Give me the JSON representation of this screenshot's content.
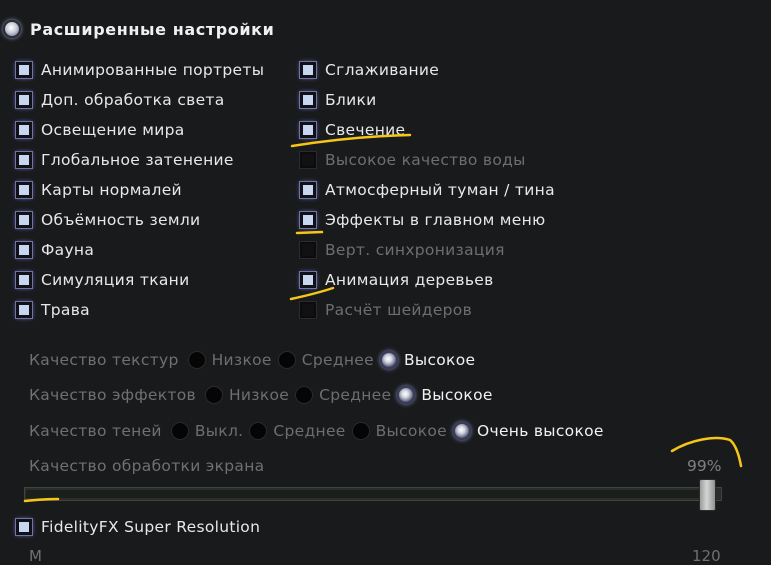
{
  "section": {
    "title": "Расширенные настройки"
  },
  "checkboxes_left": [
    {
      "label": "Анимированные портреты",
      "checked": true
    },
    {
      "label": "Доп. обработка света",
      "checked": true
    },
    {
      "label": "Освещение мира",
      "checked": true
    },
    {
      "label": "Глобальное затенение",
      "checked": true
    },
    {
      "label": "Карты нормалей",
      "checked": true
    },
    {
      "label": "Объёмность земли",
      "checked": true
    },
    {
      "label": "Фауна",
      "checked": true
    },
    {
      "label": "Симуляция ткани",
      "checked": true
    },
    {
      "label": "Трава",
      "checked": true
    }
  ],
  "checkboxes_right": [
    {
      "label": "Сглаживание",
      "checked": true
    },
    {
      "label": "Блики",
      "checked": true
    },
    {
      "label": "Свечение",
      "checked": true
    },
    {
      "label": "Высокое качество воды",
      "checked": false
    },
    {
      "label": "Атмосферный туман / тина",
      "checked": true
    },
    {
      "label": "Эффекты в главном меню",
      "checked": true
    },
    {
      "label": "Верт. синхронизация",
      "checked": false
    },
    {
      "label": "Анимация деревьев",
      "checked": true
    },
    {
      "label": "Расчёт шейдеров",
      "checked": false
    }
  ],
  "quality": {
    "textures": {
      "label": "Качество текстур",
      "options": [
        "Низкое",
        "Среднее",
        "Высокое"
      ],
      "selected": 2
    },
    "effects": {
      "label": "Качество эффектов",
      "options": [
        "Низкое",
        "Среднее",
        "Высокое"
      ],
      "selected": 2
    },
    "shadows": {
      "label": "Качество теней",
      "options": [
        "Выкл.",
        "Среднее",
        "Высокое",
        "Очень высокое"
      ],
      "selected": 3
    }
  },
  "screen_processing": {
    "label": "Качество обработки экрана",
    "value_text": "99%",
    "value": 0.99
  },
  "fsr": {
    "label": "FidelityFX Super Resolution",
    "checked": true
  },
  "bottom_row": {
    "left_text": "М",
    "right_text": "120"
  },
  "colors": {
    "accent": "#6e72b8",
    "annotation": "#f5c518",
    "background": "#191a1c"
  }
}
